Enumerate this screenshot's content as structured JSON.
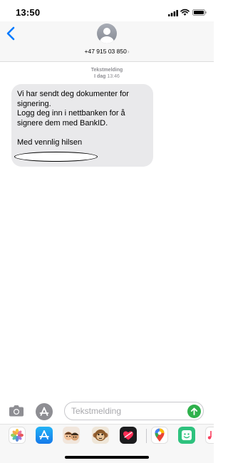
{
  "status_bar": {
    "time": "13:50"
  },
  "header": {
    "contact_number": "+47 915 03 850",
    "contact_chevron": "›"
  },
  "conversation": {
    "service_label": "Tekstmelding",
    "timestamp_day": "I dag",
    "timestamp_time": "13:46",
    "message": {
      "line1": "Vi har sendt deg dokumenter for",
      "line2": "signering.",
      "line3": "Logg deg inn i nettbanken for å",
      "line4": "signere dem med BankID.",
      "line5": "Med vennlig hilsen"
    }
  },
  "composer": {
    "placeholder": "Tekstmelding"
  },
  "app_drawer": {
    "apps": [
      "photos-icon",
      "app-store-icon",
      "memoji-icon",
      "animoji-icon",
      "digital-touch-icon",
      "google-maps-icon",
      "sticker-app-icon",
      "music-icon"
    ]
  },
  "colors": {
    "accent_blue": "#007aff",
    "bubble_gray": "#e9e9eb",
    "send_green": "#2fb14c"
  }
}
